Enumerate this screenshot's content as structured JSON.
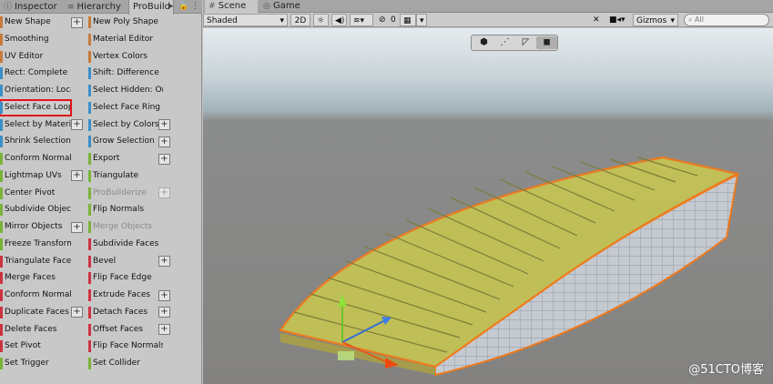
{
  "left_tabs": {
    "inspector": "Inspector",
    "hierarchy": "Hierarchy",
    "probuilder": "ProBuild"
  },
  "probuilder_buttons": {
    "col1": [
      {
        "label": "New Shape",
        "color": "#c67a3b",
        "plus": true,
        "disabled": false,
        "highlighted": false
      },
      {
        "label": "Smoothing",
        "color": "#c67a3b",
        "plus": false,
        "disabled": false,
        "highlighted": false
      },
      {
        "label": "UV Editor",
        "color": "#c67a3b",
        "plus": false,
        "disabled": false,
        "highlighted": false
      },
      {
        "label": "Rect: Complete",
        "color": "#3a8fc7",
        "plus": false,
        "disabled": false,
        "highlighted": false
      },
      {
        "label": "Orientation: Local",
        "color": "#3a8fc7",
        "plus": false,
        "disabled": false,
        "highlighted": false
      },
      {
        "label": "Select Face Loop",
        "color": "#3a8fc7",
        "plus": false,
        "disabled": false,
        "highlighted": true
      },
      {
        "label": "Select by Material",
        "color": "#3a8fc7",
        "plus": true,
        "disabled": false,
        "highlighted": false
      },
      {
        "label": "Shrink Selection",
        "color": "#3a8fc7",
        "plus": false,
        "disabled": false,
        "highlighted": false
      },
      {
        "label": "Conform Normals",
        "color": "#79b33a",
        "plus": false,
        "disabled": false,
        "highlighted": false
      },
      {
        "label": "Lightmap UVs",
        "color": "#79b33a",
        "plus": true,
        "disabled": false,
        "highlighted": false
      },
      {
        "label": "Center Pivot",
        "color": "#79b33a",
        "plus": false,
        "disabled": false,
        "highlighted": false
      },
      {
        "label": "Subdivide Object",
        "color": "#79b33a",
        "plus": false,
        "disabled": false,
        "highlighted": false
      },
      {
        "label": "Mirror Objects",
        "color": "#79b33a",
        "plus": true,
        "disabled": false,
        "highlighted": false
      },
      {
        "label": "Freeze Transform",
        "color": "#79b33a",
        "plus": false,
        "disabled": false,
        "highlighted": false
      },
      {
        "label": "Triangulate Faces",
        "color": "#cc3340",
        "plus": false,
        "disabled": false,
        "highlighted": false
      },
      {
        "label": "Merge Faces",
        "color": "#cc3340",
        "plus": false,
        "disabled": false,
        "highlighted": false
      },
      {
        "label": "Conform Normals",
        "color": "#cc3340",
        "plus": false,
        "disabled": false,
        "highlighted": false
      },
      {
        "label": "Duplicate Faces",
        "color": "#cc3340",
        "plus": true,
        "disabled": false,
        "highlighted": false
      },
      {
        "label": "Delete Faces",
        "color": "#cc3340",
        "plus": false,
        "disabled": false,
        "highlighted": false
      },
      {
        "label": "Set Pivot",
        "color": "#cc3340",
        "plus": false,
        "disabled": false,
        "highlighted": false
      },
      {
        "label": "Set Trigger",
        "color": "#79b33a",
        "plus": false,
        "disabled": false,
        "highlighted": false
      }
    ],
    "col2": [
      {
        "label": "New Poly Shape",
        "color": "#c67a3b",
        "plus": false,
        "disabled": false
      },
      {
        "label": "Material Editor",
        "color": "#c67a3b",
        "plus": false,
        "disabled": false
      },
      {
        "label": "Vertex Colors",
        "color": "#c67a3b",
        "plus": false,
        "disabled": false
      },
      {
        "label": "Shift: Difference",
        "color": "#3a8fc7",
        "plus": false,
        "disabled": false
      },
      {
        "label": "Select Hidden: On",
        "color": "#3a8fc7",
        "plus": false,
        "disabled": false
      },
      {
        "label": "Select Face Ring",
        "color": "#3a8fc7",
        "plus": false,
        "disabled": false
      },
      {
        "label": "Select by Colors",
        "color": "#3a8fc7",
        "plus": true,
        "disabled": false
      },
      {
        "label": "Grow Selection",
        "color": "#3a8fc7",
        "plus": true,
        "disabled": false
      },
      {
        "label": "Export",
        "color": "#79b33a",
        "plus": true,
        "disabled": false
      },
      {
        "label": "Triangulate",
        "color": "#79b33a",
        "plus": false,
        "disabled": false
      },
      {
        "label": "ProBuilderize",
        "color": "#79b33a",
        "plus": true,
        "disabled": true
      },
      {
        "label": "Flip Normals",
        "color": "#79b33a",
        "plus": false,
        "disabled": false
      },
      {
        "label": "Merge Objects",
        "color": "#79b33a",
        "plus": false,
        "disabled": true
      },
      {
        "label": "Subdivide Faces",
        "color": "#cc3340",
        "plus": false,
        "disabled": false
      },
      {
        "label": "Bevel",
        "color": "#cc3340",
        "plus": true,
        "disabled": false
      },
      {
        "label": "Flip Face Edge",
        "color": "#cc3340",
        "plus": false,
        "disabled": false
      },
      {
        "label": "Extrude Faces",
        "color": "#cc3340",
        "plus": true,
        "disabled": false
      },
      {
        "label": "Detach Faces",
        "color": "#cc3340",
        "plus": true,
        "disabled": false
      },
      {
        "label": "Offset Faces",
        "color": "#cc3340",
        "plus": true,
        "disabled": false
      },
      {
        "label": "Flip Face Normals",
        "color": "#cc3340",
        "plus": false,
        "disabled": false
      },
      {
        "label": "Set Collider",
        "color": "#79b33a",
        "plus": false,
        "disabled": false
      }
    ],
    "plus_label": "+"
  },
  "scene_tabs": {
    "scene": "Scene",
    "game": "Game"
  },
  "scene_toolbar": {
    "shading": "Shaded",
    "mode_2d": "2D",
    "hidden_count": "0",
    "gizmos": "Gizmos",
    "search_placeholder": "All"
  },
  "watermark": "@51CTO博客",
  "colors": {
    "selection_face": "#c4c255",
    "selection_outline": "#f07a1c",
    "highlight_outline": "#e0141c"
  }
}
